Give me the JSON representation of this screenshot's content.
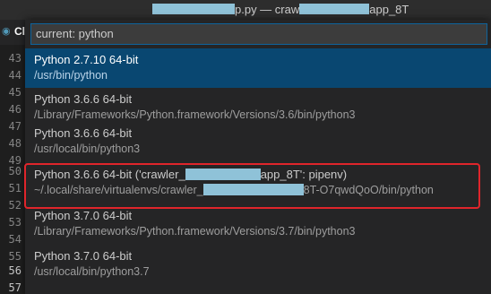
{
  "titlebar": {
    "title_suffix": "p.py — craw",
    "title_end": "app_8T"
  },
  "tab": {
    "label": "Cl"
  },
  "gutter": {
    "lines": [
      "43",
      "44",
      "45",
      "46",
      "47",
      "48",
      "49",
      "50",
      "51",
      "52",
      "53",
      "54",
      "55",
      "56",
      "57"
    ],
    "active_lines": [
      "56",
      "57"
    ]
  },
  "quick_pick": {
    "input_value": "current: python",
    "items": [
      {
        "label": "Python 2.7.10 64-bit",
        "detail": "/usr/bin/python",
        "selected": true
      },
      {
        "label": "Python 3.6.6 64-bit",
        "detail": "/Library/Frameworks/Python.framework/Versions/3.6/bin/python3",
        "selected": false
      },
      {
        "label": "Python 3.6.6 64-bit",
        "detail": "/usr/local/bin/python3",
        "selected": false
      },
      {
        "label_pre": "Python 3.6.6 64-bit ('crawler_",
        "label_post": "app_8T': pipenv)",
        "detail_pre": "~/.local/share/virtualenvs/crawler_",
        "detail_post": "8T-O7qwdQoO/bin/python",
        "selected": false
      },
      {
        "label": "Python 3.7.0 64-bit",
        "detail": "/Library/Frameworks/Python.framework/Versions/3.7/bin/python3",
        "selected": false
      },
      {
        "label": "Python 3.7.0 64-bit",
        "detail": "/usr/local/bin/python3.7",
        "selected": false
      }
    ]
  },
  "colors": {
    "selected_bg": "#094771",
    "highlight_border": "#e0252b",
    "redaction": "#8fc2d8"
  }
}
